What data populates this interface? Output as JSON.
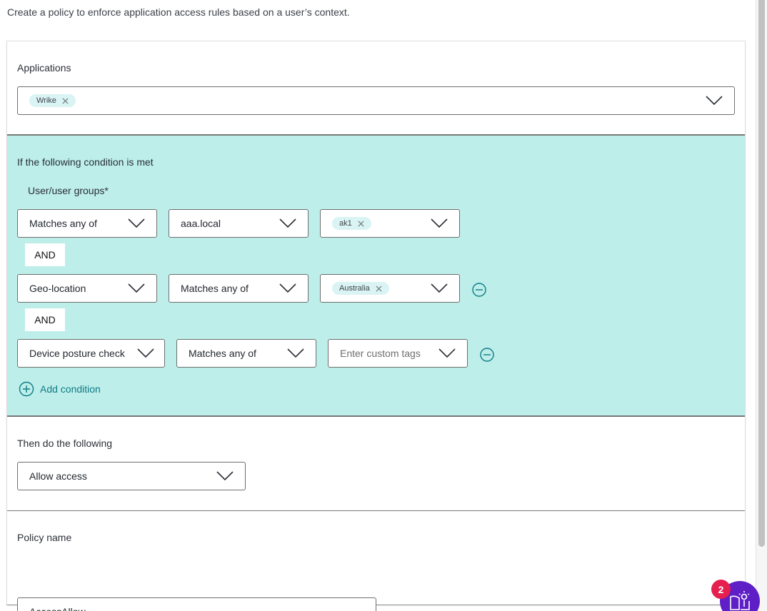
{
  "intro": "Create a policy to enforce application access rules based on a user’s context.",
  "applications": {
    "label": "Applications",
    "selected": [
      "Wrike"
    ]
  },
  "conditions": {
    "heading": "If the following condition is met",
    "first_sublabel": "User/user groups*",
    "connector": "AND",
    "rows": [
      {
        "field": "Matches any of",
        "operator": "aaa.local",
        "values": [
          "ak1"
        ],
        "removable": false
      },
      {
        "field": "Geo-location",
        "operator": "Matches any of",
        "values": [
          "Australia"
        ],
        "removable": true
      },
      {
        "field": "Device posture check",
        "operator": "Matches any of",
        "values": [],
        "placeholder": "Enter custom tags",
        "removable": true
      }
    ],
    "add_label": "Add condition"
  },
  "action": {
    "label": "Then do the following",
    "selected": "Allow access"
  },
  "policy_name": {
    "label": "Policy name",
    "value": "AccessAllow"
  },
  "help": {
    "badge_count": "2",
    "icon": "book-lightbulb-icon"
  },
  "colors": {
    "condition_bg": "#bdeeea",
    "accent": "#0f7b86",
    "chip_bg": "#daf3f3",
    "fab": "#5f1fc7",
    "badge": "#e51f4e"
  }
}
